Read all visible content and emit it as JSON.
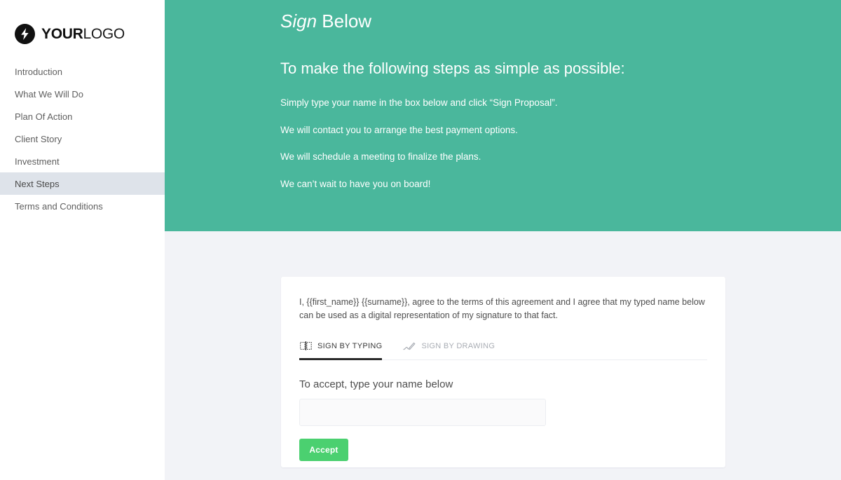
{
  "brand": {
    "logo_icon": "lightning-bolt-icon",
    "name_bold": "YOUR",
    "name_light": "LOGO"
  },
  "sidebar": {
    "items": [
      {
        "label": "Introduction",
        "active": false
      },
      {
        "label": "What We Will Do",
        "active": false
      },
      {
        "label": "Plan Of Action",
        "active": false
      },
      {
        "label": "Client Story",
        "active": false
      },
      {
        "label": "Investment",
        "active": false
      },
      {
        "label": "Next Steps",
        "active": true
      },
      {
        "label": "Terms and Conditions",
        "active": false
      }
    ],
    "active_item": "Next Steps"
  },
  "hero": {
    "title_italic": "Sign",
    "title_rest": " Below",
    "subtitle": "To make the following steps as simple as possible:",
    "lines": [
      "Simply type your name in the box below and click “Sign Proposal”.",
      "We will contact you to arrange the best payment options.",
      "We will schedule a meeting to finalize the plans.",
      "We can’t wait to have you on board!"
    ],
    "background_color": "#4ab79c"
  },
  "card": {
    "agreement_text": "I, {{first_name}} {{surname}}, agree to the terms of this agreement and I agree that my typed name below can be used as a digital representation of my signature to that fact.",
    "tabs": [
      {
        "label": "SIGN BY TYPING",
        "icon": "keyboard-icon",
        "active": true
      },
      {
        "label": "SIGN BY DRAWING",
        "icon": "pen-icon",
        "active": false
      }
    ],
    "field_label": "To accept, type your name below",
    "input_value": "",
    "input_placeholder": "",
    "accept_label": "Accept",
    "accept_color": "#4bd070"
  }
}
